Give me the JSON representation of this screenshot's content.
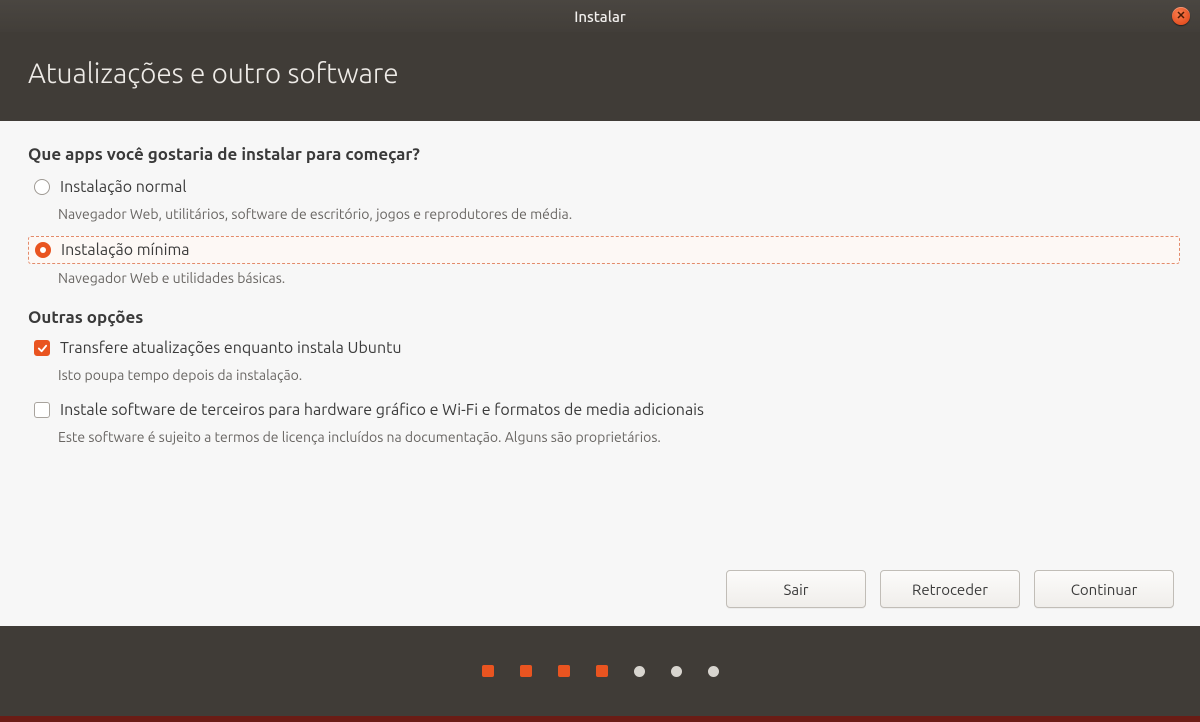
{
  "window": {
    "title": "Instalar"
  },
  "header": {
    "heading": "Atualizações e outro software"
  },
  "content": {
    "question": "Que apps você gostaria de instalar para começar?",
    "install_options": [
      {
        "id": "normal",
        "label": "Instalação normal",
        "desc": "Navegador Web, utilitários, software de escritório, jogos e reprodutores de média.",
        "checked": false
      },
      {
        "id": "minimal",
        "label": "Instalação mínima",
        "desc": "Navegador Web e utilidades básicas.",
        "checked": true
      }
    ],
    "other_options_heading": "Outras opções",
    "other_options": [
      {
        "id": "download-updates",
        "label": "Transfere atualizações enquanto instala Ubuntu",
        "desc": "Isto poupa tempo depois da instalação.",
        "checked": true
      },
      {
        "id": "third-party",
        "label": "Instale software de terceiros para hardware gráfico e Wi-Fi e formatos de media adicionais",
        "desc": "Este software é sujeito a termos de licença incluídos na documentação. Alguns são proprietários.",
        "checked": false
      }
    ]
  },
  "buttons": {
    "quit": "Sair",
    "back": "Retroceder",
    "continue": "Continuar"
  },
  "progress": {
    "total_steps": 7,
    "current_step": 4
  }
}
